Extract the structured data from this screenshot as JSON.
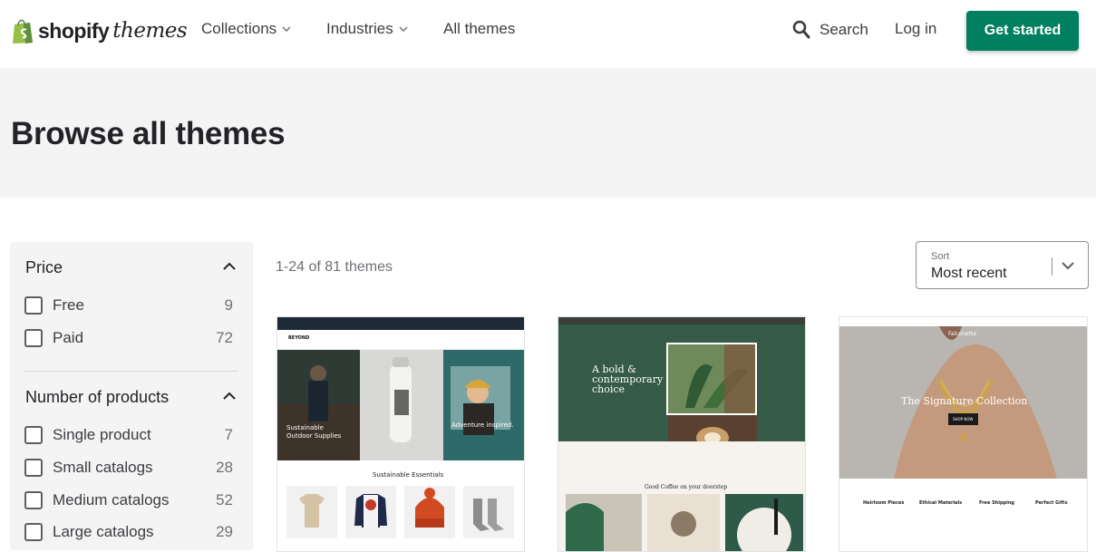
{
  "header": {
    "logo_brand": "shopify",
    "logo_suffix": "themes",
    "nav": [
      {
        "label": "Collections",
        "has_dropdown": true
      },
      {
        "label": "Industries",
        "has_dropdown": true
      },
      {
        "label": "All themes",
        "has_dropdown": false
      }
    ],
    "search_label": "Search",
    "login_label": "Log in",
    "cta_label": "Get started"
  },
  "hero": {
    "title": "Browse all themes"
  },
  "filters": {
    "price": {
      "title": "Price",
      "options": [
        {
          "label": "Free",
          "count": "9",
          "checked": false
        },
        {
          "label": "Paid",
          "count": "72",
          "checked": false
        }
      ]
    },
    "products": {
      "title": "Number of products",
      "options": [
        {
          "label": "Single product",
          "count": "7",
          "checked": false
        },
        {
          "label": "Small catalogs",
          "count": "28",
          "checked": false
        },
        {
          "label": "Medium catalogs",
          "count": "52",
          "checked": false
        },
        {
          "label": "Large catalogs",
          "count": "29",
          "checked": false
        }
      ]
    }
  },
  "results": {
    "count_text": "1-24 of 81 themes",
    "sort_label": "Sort",
    "sort_value": "Most recent"
  },
  "cards": [
    {
      "brand": "BEYOND",
      "hero_left": "Sustainable Outdoor Supplies",
      "hero_right": "Adventure inspired.",
      "section_title": "Sustainable Essentials"
    },
    {
      "heading": "A bold & contemporary choice",
      "section_title": "Good Coffee on your doorstep"
    },
    {
      "brand": "Falconette",
      "hero_title": "The Signature Collection",
      "button": "SHOP NOW",
      "features": [
        "Heirloom Pieces",
        "Ethical Materials",
        "Free Shipping",
        "Perfect Gifts"
      ]
    }
  ],
  "colors": {
    "brand_green": "#008060",
    "hero_bg": "#f4f4f5",
    "text": "#212326",
    "muted": "#6d7175"
  }
}
